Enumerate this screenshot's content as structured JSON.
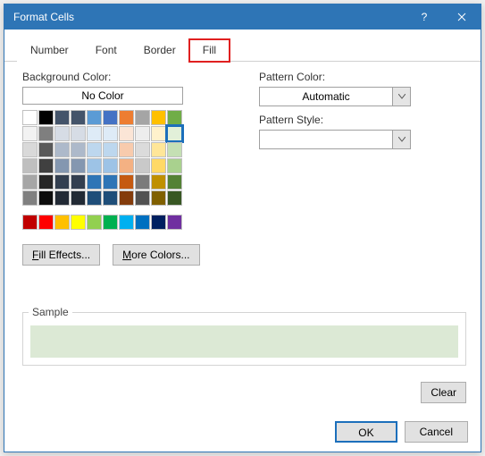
{
  "dialog": {
    "title": "Format Cells",
    "help_icon": "?",
    "tabs": [
      "Number",
      "Font",
      "Border",
      "Fill"
    ],
    "active_tab": 3
  },
  "fill": {
    "background_label": "Background Color:",
    "no_color": "No Color",
    "main_palette": [
      [
        "#ffffff",
        "#000000",
        "#44546a",
        "#44546a",
        "#5b9bd5",
        "#4472c4",
        "#ed7d31",
        "#a5a5a5",
        "#ffc000",
        "#70ad47"
      ],
      [
        "#f2f2f2",
        "#7f7f7f",
        "#d6dce5",
        "#d6dce5",
        "#deebf7",
        "#deebf7",
        "#fbe5d6",
        "#ededed",
        "#fff2cc",
        "#e2f0d9"
      ],
      [
        "#d9d9d9",
        "#595959",
        "#adb9ca",
        "#adb9ca",
        "#bdd7ee",
        "#bdd7ee",
        "#f8cbad",
        "#dbdbdb",
        "#ffe699",
        "#c5e0b4"
      ],
      [
        "#bfbfbf",
        "#404040",
        "#8497b0",
        "#8497b0",
        "#9dc3e6",
        "#9dc3e6",
        "#f4b183",
        "#c9c9c9",
        "#ffd966",
        "#a9d18e"
      ],
      [
        "#a6a6a6",
        "#262626",
        "#333f50",
        "#333f50",
        "#2e75b6",
        "#2e75b6",
        "#c55a11",
        "#7b7b7b",
        "#bf9000",
        "#548235"
      ],
      [
        "#808080",
        "#0d0d0d",
        "#222a35",
        "#222a35",
        "#1f4e79",
        "#1f4e79",
        "#843c0c",
        "#525252",
        "#806000",
        "#385723"
      ]
    ],
    "selected_cell": {
      "row": 1,
      "col": 9
    },
    "standard_palette": [
      "#c00000",
      "#ff0000",
      "#ffc000",
      "#ffff00",
      "#92d050",
      "#00b050",
      "#00b0f0",
      "#0070c0",
      "#002060",
      "#7030a0"
    ],
    "fill_effects": "Fill Effects...",
    "more_colors": "More Colors..."
  },
  "pattern": {
    "color_label": "Pattern Color:",
    "color_value": "Automatic",
    "style_label": "Pattern Style:",
    "style_value": ""
  },
  "sample": {
    "label": "Sample",
    "color": "#dce9d5"
  },
  "buttons": {
    "clear": "Clear",
    "ok": "OK",
    "cancel": "Cancel"
  }
}
